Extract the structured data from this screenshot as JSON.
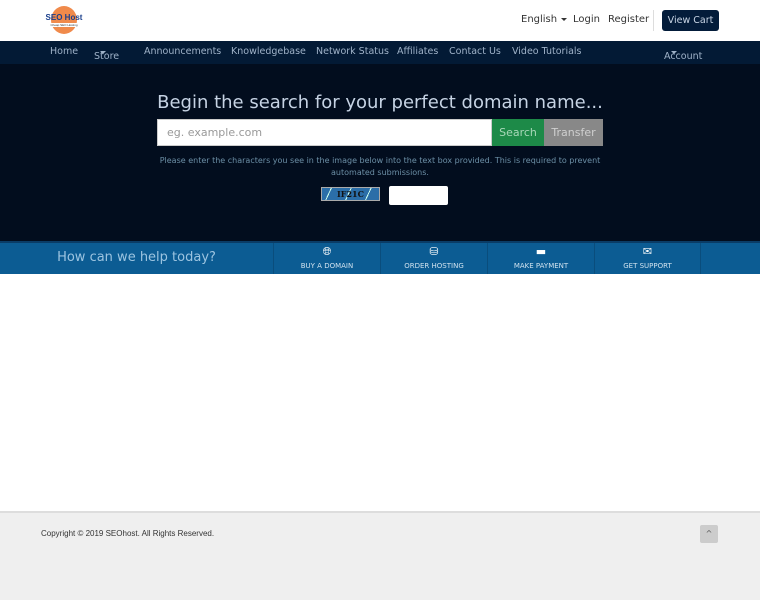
{
  "header": {
    "logo_text": "SEO Host",
    "logo_sub": "Cheap SEO Hosting",
    "language": "English",
    "login": "Login",
    "register": "Register",
    "view_cart": "View Cart"
  },
  "nav": {
    "items": [
      "Home",
      "Store",
      "Announcements",
      "Knowledgebase",
      "Network Status",
      "Affiliates",
      "Contact Us",
      "Video Tutorials"
    ],
    "account": "Account"
  },
  "hero": {
    "title": "Begin the search for your perfect domain name...",
    "placeholder": "eg. example.com",
    "search": "Search",
    "transfer": "Transfer",
    "captcha_note": "Please enter the characters you see in the image below into the text box provided. This is required to prevent automated submissions.",
    "captcha_code": "IF21C"
  },
  "help": {
    "question": "How can we help today?",
    "actions": [
      {
        "label": "BUY A DOMAIN",
        "icon": "globe-icon"
      },
      {
        "label": "ORDER HOSTING",
        "icon": "server-icon"
      },
      {
        "label": "MAKE PAYMENT",
        "icon": "credit-card-icon"
      },
      {
        "label": "GET SUPPORT",
        "icon": "envelope-icon"
      }
    ]
  },
  "footer": {
    "copyright": "Copyright © 2019 SEOhost. All Rights Reserved.",
    "back_to_top": "^"
  }
}
